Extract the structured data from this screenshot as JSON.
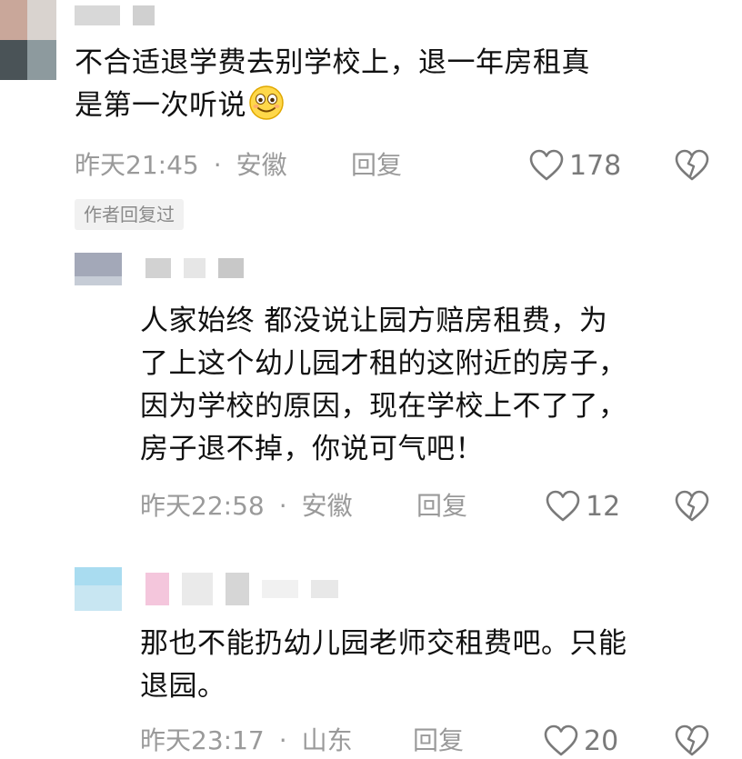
{
  "comments": [
    {
      "text_line1": "不合适退学费去别学校上，退一年房租真",
      "text_line2": "是第一次听说",
      "emoji_icon": "smiling-face-emoji",
      "time": "昨天21:45",
      "separator": "·",
      "location": "安徽",
      "reply_label": "回复",
      "likes": "178",
      "author_tag": "作者回复过"
    },
    {
      "lines": [
        "人家始终 都没说让园方赔房租费，为",
        "了上这个幼儿园才租的这附近的房子，",
        "因为学校的原因，现在学校上不了了，",
        "房子退不掉，你说可气吧！"
      ],
      "time": "昨天22:58",
      "separator": "·",
      "location": "安徽",
      "reply_label": "回复",
      "likes": "12"
    },
    {
      "lines": [
        "那也不能扔幼儿园老师交租费吧。只能",
        "退园。"
      ],
      "time": "昨天23:17",
      "separator": "·",
      "location": "山东",
      "reply_label": "回复",
      "likes": "20"
    }
  ],
  "colors": {
    "text": "#111111",
    "meta": "#9a9a9a",
    "like_icon": "#7a7a7a",
    "tag_bg": "#f1f1f1"
  }
}
